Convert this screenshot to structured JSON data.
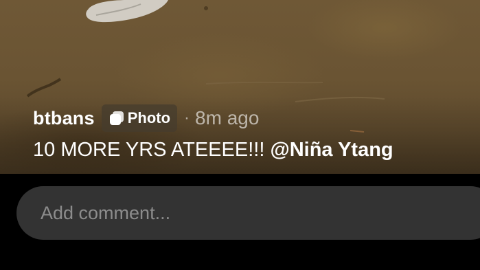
{
  "post": {
    "username": "btbans",
    "badge": {
      "icon": "photo-icon",
      "label": "Photo"
    },
    "separator": "·",
    "time_ago": "8m ago",
    "caption_text": "10 MORE YRS ATEEEE!!! ",
    "mention": "@Niña Ytang"
  },
  "comment": {
    "placeholder": "Add comment...",
    "value": ""
  },
  "colors": {
    "background": "#000000",
    "comment_bar": "#333333",
    "placeholder": "#8c8c8c",
    "text": "#ffffff"
  }
}
